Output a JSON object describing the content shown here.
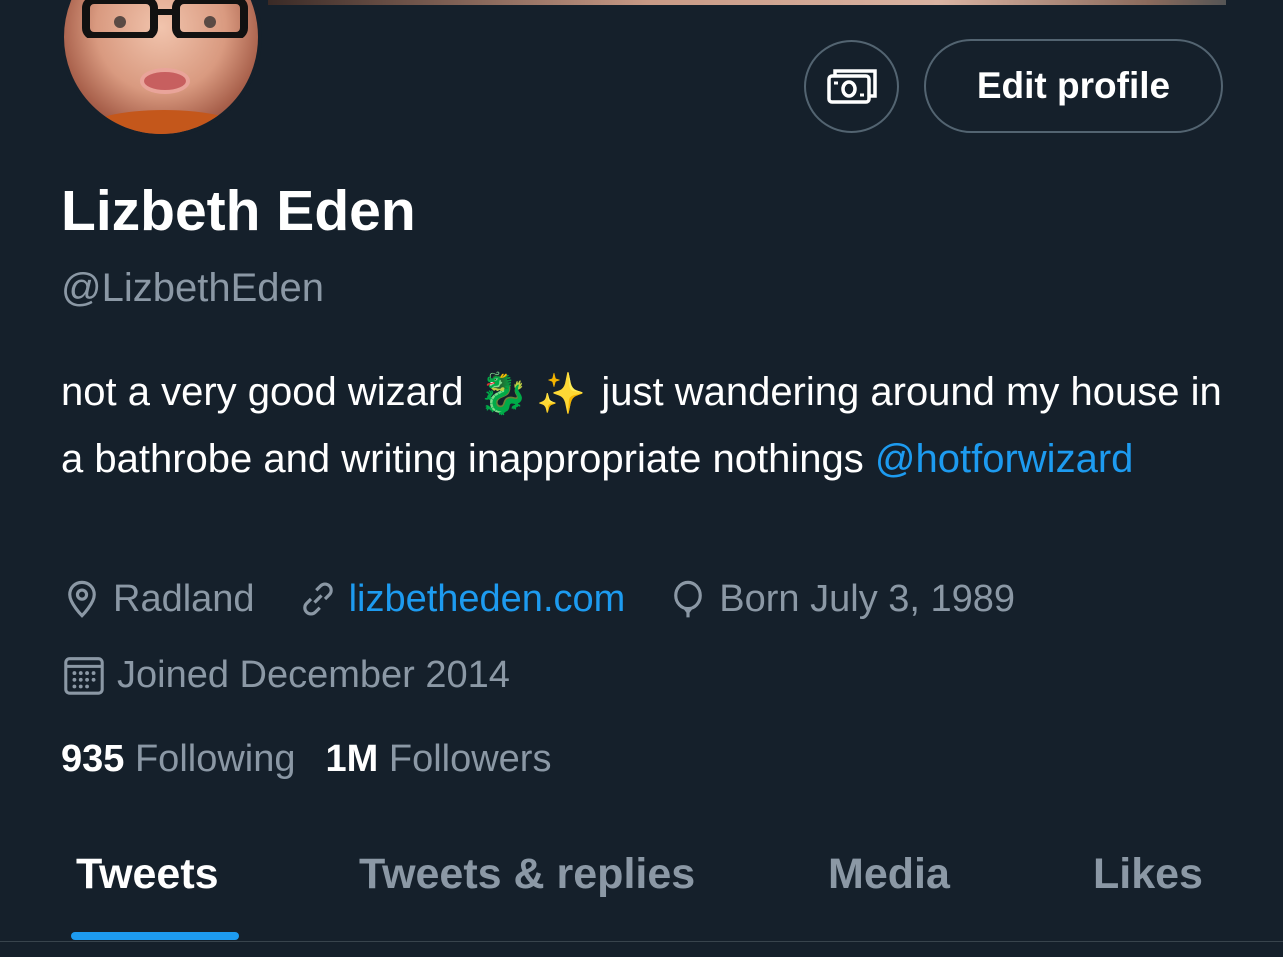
{
  "profile": {
    "display_name": "Lizbeth Eden",
    "handle": "@LizbethEden",
    "bio": {
      "part1": "not a very good wizard",
      "emoji1": "🐉",
      "emoji2": "✨",
      "part2": "just wandering around my house in a bathrobe and writing inappropriate nothings",
      "mention": "@hotforwizard"
    },
    "location": "Radland",
    "website": "lizbetheden.com",
    "birthday": "Born July 3, 1989",
    "joined": "Joined December 2014"
  },
  "buttons": {
    "edit_profile": "Edit profile"
  },
  "stats": {
    "following_count": "935",
    "following_label": "Following",
    "followers_count": "1M",
    "followers_label": "Followers"
  },
  "tabs": [
    {
      "label": "Tweets",
      "active": true
    },
    {
      "label": "Tweets & replies",
      "active": false
    },
    {
      "label": "Media",
      "active": false
    },
    {
      "label": "Likes",
      "active": false
    }
  ],
  "icons": {
    "tip_jar": "money-icon",
    "location": "location-pin-icon",
    "website": "link-icon",
    "birthday": "balloon-icon",
    "joined": "calendar-icon"
  },
  "colors": {
    "background": "#15202b",
    "accent": "#1d9bf0",
    "secondary_text": "#8b98a5",
    "border": "#536471"
  }
}
